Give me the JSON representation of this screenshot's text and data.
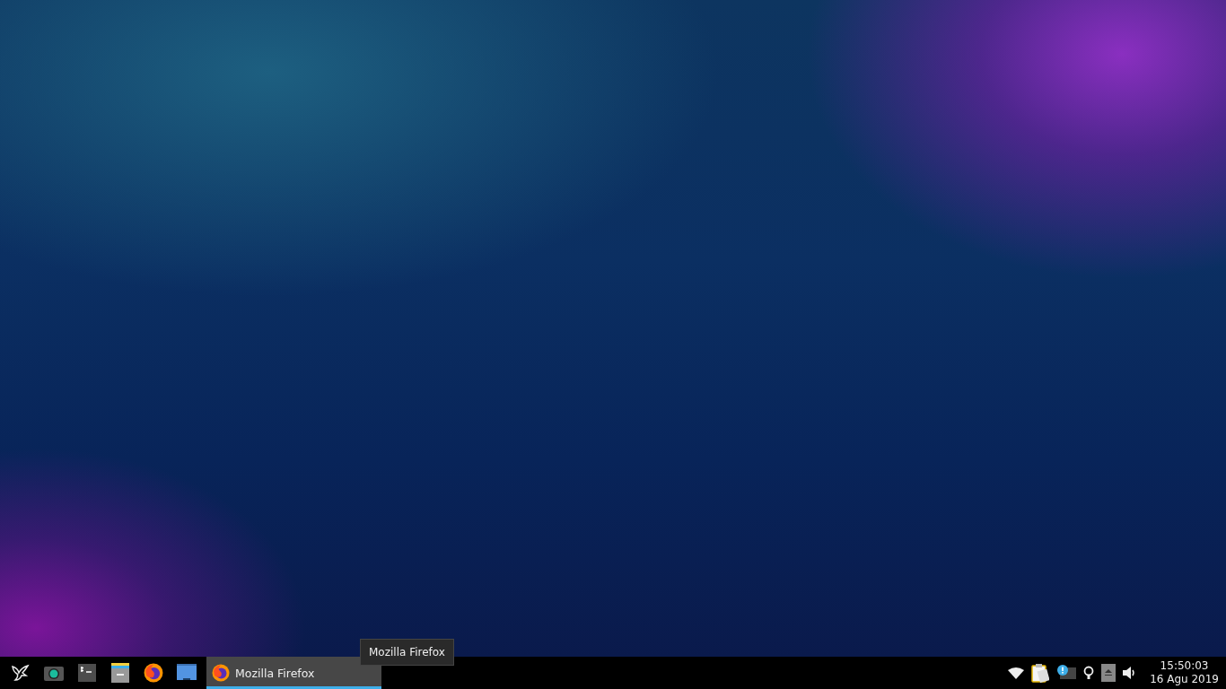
{
  "tasks": [
    {
      "label": "Mozilla Firefox",
      "selected": true
    }
  ],
  "tooltip": {
    "text": "Mozilla Firefox"
  },
  "clock": {
    "time": "15:50:03",
    "date": "16 Agu 2019"
  }
}
